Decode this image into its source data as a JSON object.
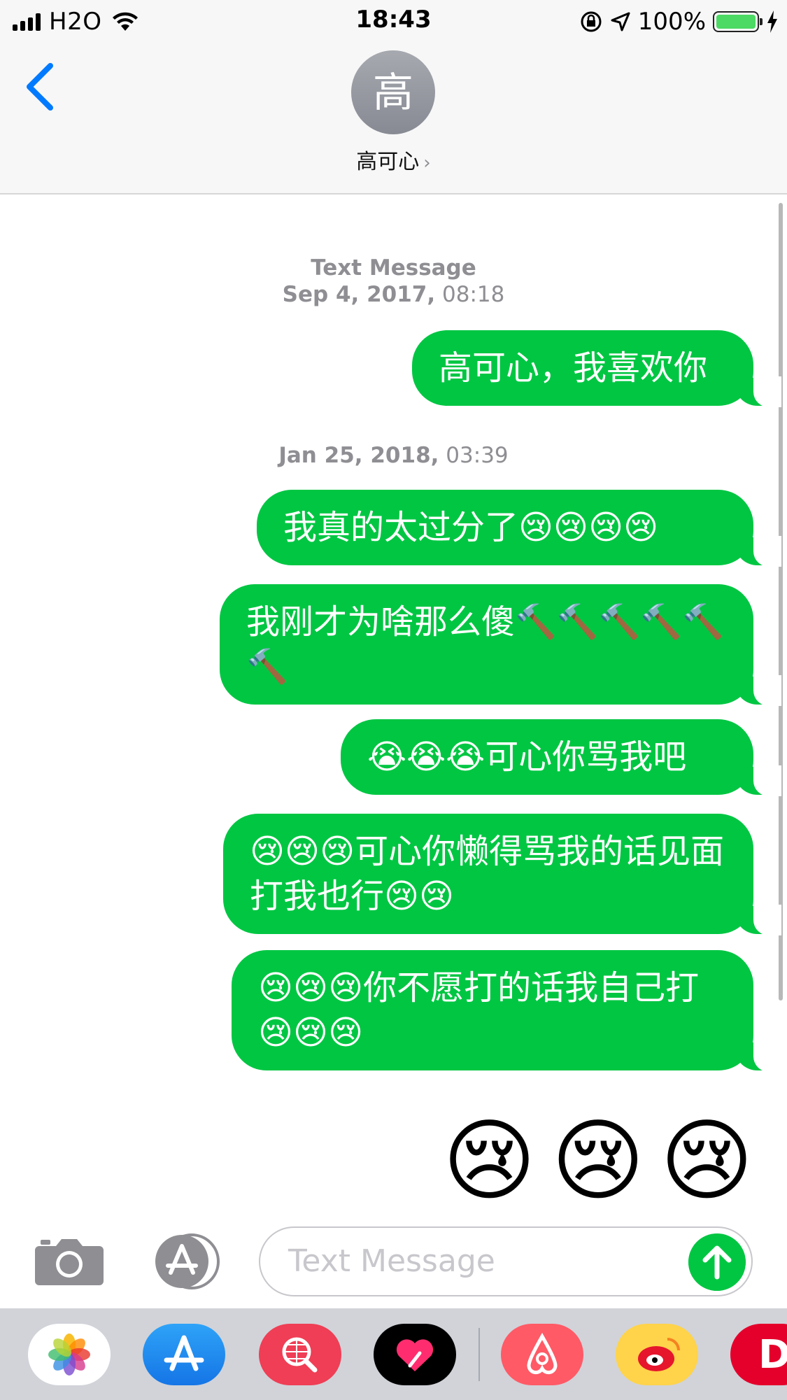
{
  "status_bar": {
    "carrier": "H2O",
    "time": "18:43",
    "battery_percent": "100%",
    "battery_level": 1.0
  },
  "header": {
    "avatar_initial": "高",
    "contact_name": "高可心",
    "contact_chevron": "›"
  },
  "thread": {
    "timestamp_1": {
      "label": "Text Message",
      "date": "Sep 4, 2017,",
      "time": "08:18"
    },
    "timestamp_2": {
      "date": "Jan 25, 2018,",
      "time": "03:39"
    },
    "messages": [
      "高可心，我喜欢你",
      "我真的太过分了😢😢😢😢",
      "我刚才为啥那么傻🔨🔨🔨🔨🔨🔨",
      "😭😭😭可心你骂我吧",
      "😢😢😢可心你懒得骂我的话见面打我也行😢😢",
      "😢😢😢你不愿打的话我自己打😢😢😢"
    ],
    "big_emojis": [
      "😢",
      "😢",
      "😢"
    ]
  },
  "composer": {
    "placeholder": "Text Message"
  },
  "icons": {
    "back": "chevron-left-icon",
    "camera": "camera-icon",
    "app_store": "app-store-icon",
    "send": "arrow-up-icon"
  },
  "drawer": {
    "apps": [
      "photos",
      "app-store",
      "web-search",
      "digital-touch",
      "airbnb",
      "weibo",
      "partial-app"
    ],
    "partial_app_letter": "D"
  },
  "colors": {
    "bubble": "#00c642",
    "accent_blue": "#007aff",
    "timestamp": "#8e8e93"
  }
}
